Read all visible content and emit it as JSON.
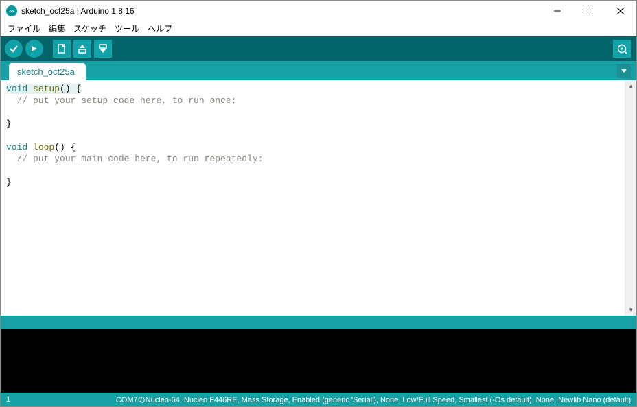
{
  "titlebar": {
    "title": "sketch_oct25a | Arduino 1.8.16"
  },
  "menubar": {
    "items": [
      "ファイル",
      "編集",
      "スケッチ",
      "ツール",
      "ヘルプ"
    ]
  },
  "tabs": {
    "active": "sketch_oct25a"
  },
  "editor": {
    "line1_kw": "void",
    "line1_fn": "setup",
    "line1_rest": "() {",
    "line2": "  // put your setup code here, to run once:",
    "line3": "",
    "line4": "}",
    "line5": "",
    "line6_kw": "void",
    "line6_fn": "loop",
    "line6_rest": "() {",
    "line7": "  // put your main code here, to run repeatedly:",
    "line8": "",
    "line9": "}"
  },
  "statusbar": {
    "line": "1",
    "board": "COM7のNucleo-64, Nucleo F446RE, Mass Storage, Enabled (generic 'Serial'), None, Low/Full Speed, Smallest (-Os default), None, Newlib Nano (default)"
  },
  "colors": {
    "teal_dark": "#006468",
    "teal": "#17a1a5",
    "teal_light": "#11a2a8"
  }
}
